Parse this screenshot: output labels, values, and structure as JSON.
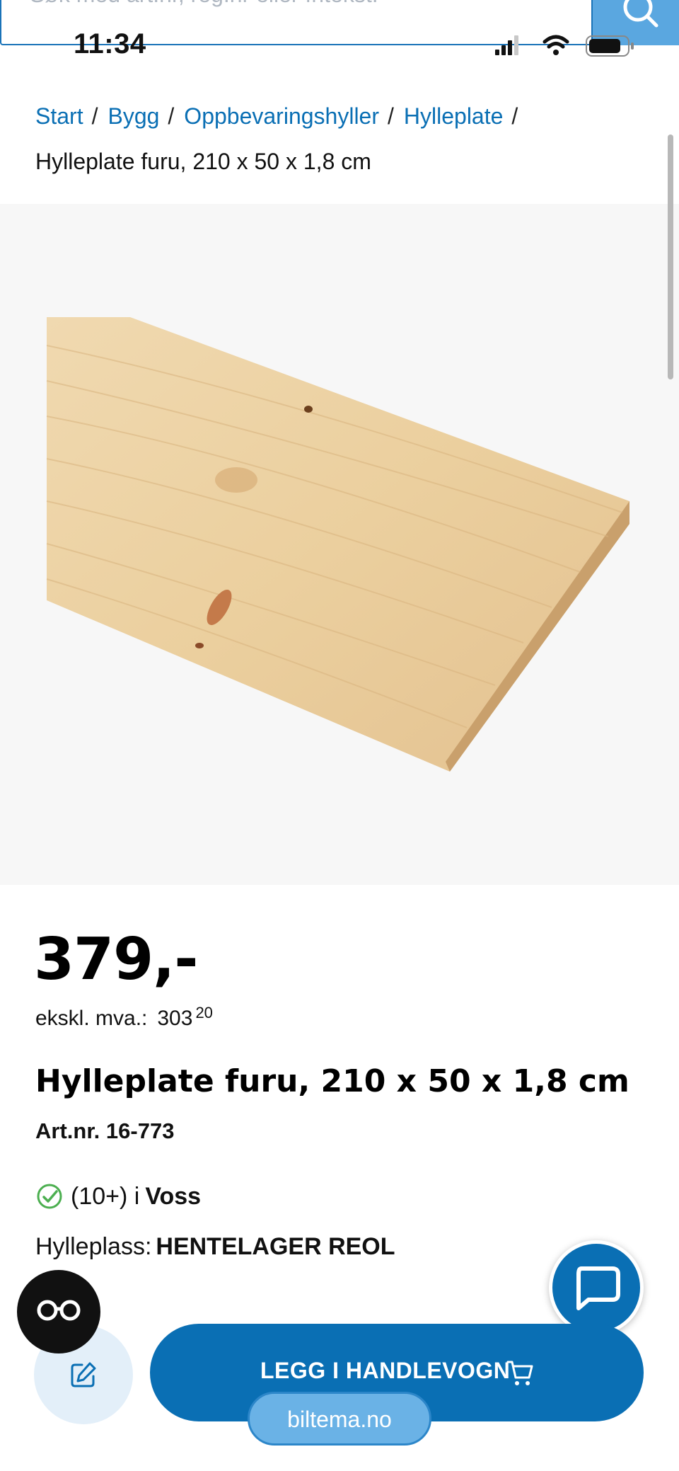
{
  "search": {
    "placeholder": "Søk med art.nr, reg.nr eller fritekst."
  },
  "status_bar": {
    "time": "11:34"
  },
  "breadcrumb": {
    "links": [
      "Start",
      "Bygg",
      "Oppbevaringshyller",
      "Hylleplate"
    ],
    "separator": "/",
    "current": "Hylleplate furu, 210 x 50 x 1,8 cm"
  },
  "product": {
    "image_alt": "pine-shelf-board",
    "price": "379,-",
    "ex_vat_label": "ekskl. mva.:",
    "ex_vat_value": "303",
    "ex_vat_decimals": "20",
    "title": "Hylleplate furu, 210 x 50 x 1,8 cm",
    "art_nr": "Art.nr. 16-773",
    "stock_count": "(10+) i",
    "stock_store": "Voss",
    "shelf_label": "Hylleplass:",
    "shelf_value": "HENTELAGER REOL"
  },
  "actions": {
    "cart_label": "LEGG I HANDLEVOGN"
  },
  "browser": {
    "url": "biltema.no"
  },
  "colors": {
    "accent": "#0a6fb4",
    "stock_ok": "#4caf50"
  }
}
